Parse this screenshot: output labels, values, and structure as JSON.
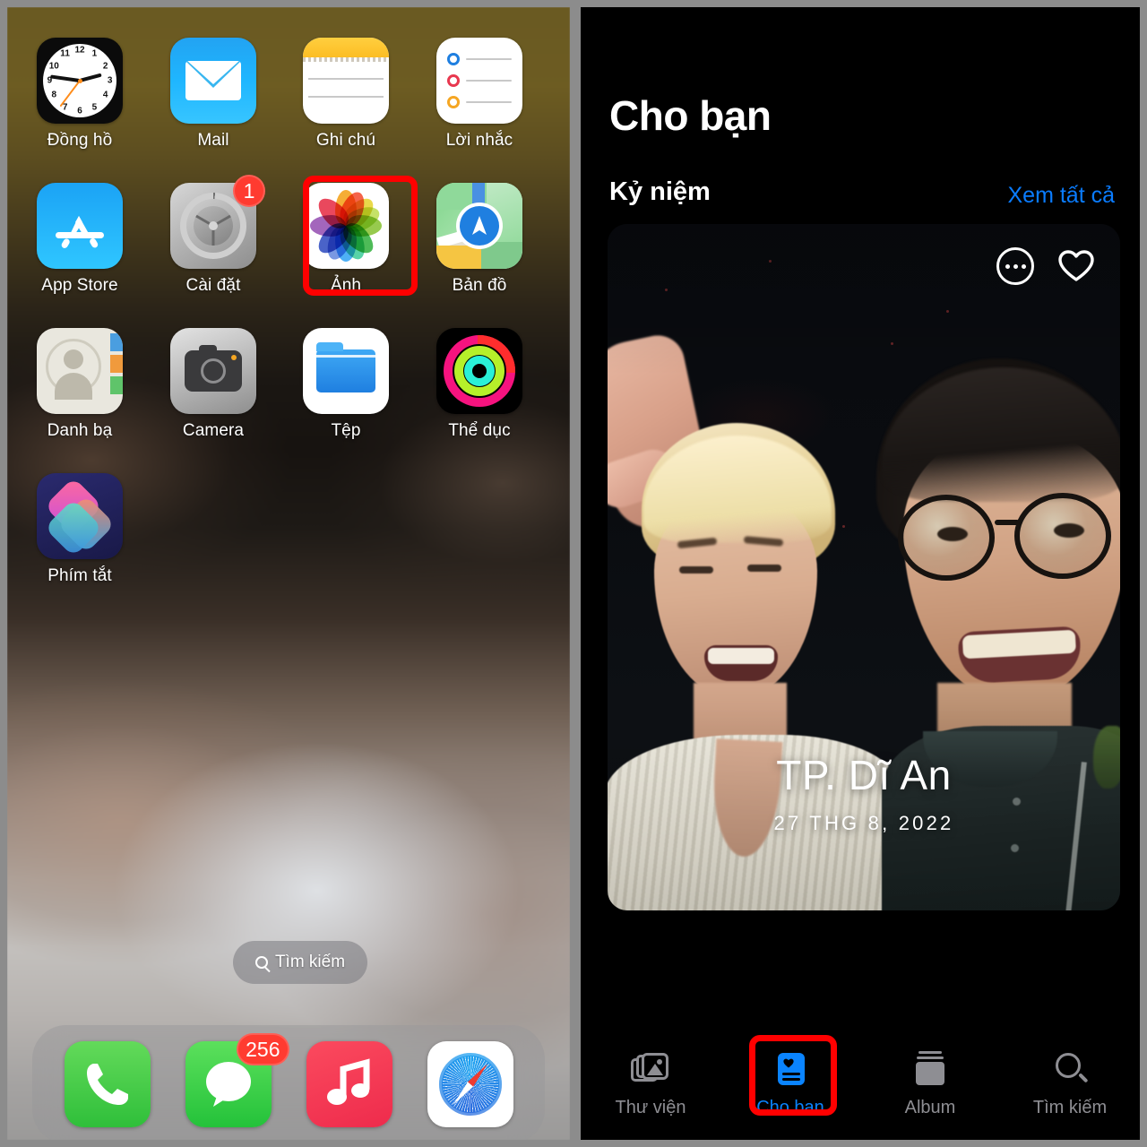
{
  "home": {
    "apps": [
      {
        "label": "Đồng hồ",
        "icon": "clock-icon"
      },
      {
        "label": "Mail",
        "icon": "mail-icon"
      },
      {
        "label": "Ghi chú",
        "icon": "notes-icon"
      },
      {
        "label": "Lời nhắc",
        "icon": "reminders-icon"
      },
      {
        "label": "App Store",
        "icon": "app-store-icon"
      },
      {
        "label": "Cài đặt",
        "icon": "settings-icon",
        "badge": "1"
      },
      {
        "label": "Ảnh",
        "icon": "photos-icon",
        "highlighted": true
      },
      {
        "label": "Bản đồ",
        "icon": "maps-icon"
      },
      {
        "label": "Danh bạ",
        "icon": "contacts-icon"
      },
      {
        "label": "Camera",
        "icon": "camera-icon"
      },
      {
        "label": "Tệp",
        "icon": "files-icon"
      },
      {
        "label": "Thể dục",
        "icon": "fitness-icon"
      },
      {
        "label": "Phím tắt",
        "icon": "shortcuts-icon"
      }
    ],
    "search": {
      "label": "Tìm kiếm",
      "icon": "search-icon"
    },
    "dock": [
      {
        "label": "Điện thoại",
        "icon": "phone-icon"
      },
      {
        "label": "Tin nhắn",
        "icon": "messages-icon",
        "badge": "256"
      },
      {
        "label": "Nhạc",
        "icon": "music-icon"
      },
      {
        "label": "Safari",
        "icon": "safari-icon"
      }
    ]
  },
  "photos": {
    "title": "Cho bạn",
    "section_title": "Kỷ niệm",
    "see_all": "Xem tất cả",
    "memory": {
      "place": "TP. Dĩ An",
      "date": "27 THG 8, 2022",
      "more_icon": "ellipsis-icon",
      "favorite_icon": "heart-icon"
    },
    "tabs": [
      {
        "label": "Thư viện",
        "icon": "library-icon",
        "active": false
      },
      {
        "label": "Cho bạn",
        "icon": "for-you-icon",
        "active": true,
        "highlighted": true
      },
      {
        "label": "Album",
        "icon": "album-icon",
        "active": false
      },
      {
        "label": "Tìm kiếm",
        "icon": "search-icon",
        "active": false
      }
    ]
  },
  "colors": {
    "accent_blue": "#0a84ff",
    "highlight_red": "#ff0000",
    "badge_red": "#ff3b30",
    "inactive_gray": "#8e8e93"
  }
}
